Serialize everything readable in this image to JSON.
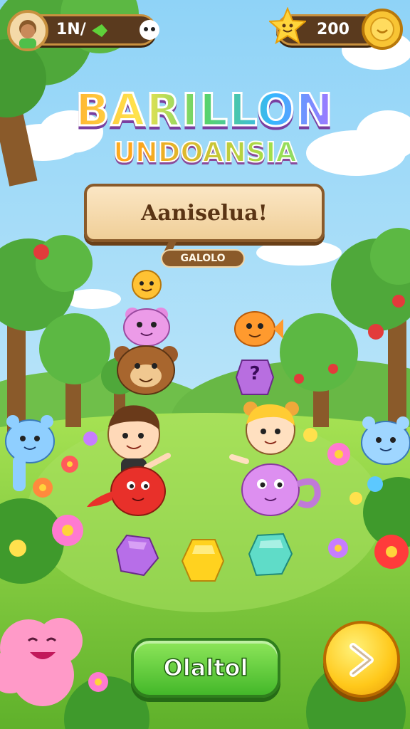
{
  "hud": {
    "level_text": "1N/",
    "coins": "200"
  },
  "title": {
    "line1": "BARILLON",
    "line2": "UNDOANSIA"
  },
  "sign": {
    "main": "Aaniselua!",
    "small": "GALOLO"
  },
  "shapes": {
    "question_mark": "?"
  },
  "buttons": {
    "play_label": "Olaltol",
    "next_icon": "chevron-right-icon"
  },
  "colors": {
    "sky": "#bfe7fb",
    "grass": "#7ccf3a",
    "play_button": "#4fc02e",
    "next_button": "#ffc81a",
    "hud_pill": "#5a3a1e"
  }
}
